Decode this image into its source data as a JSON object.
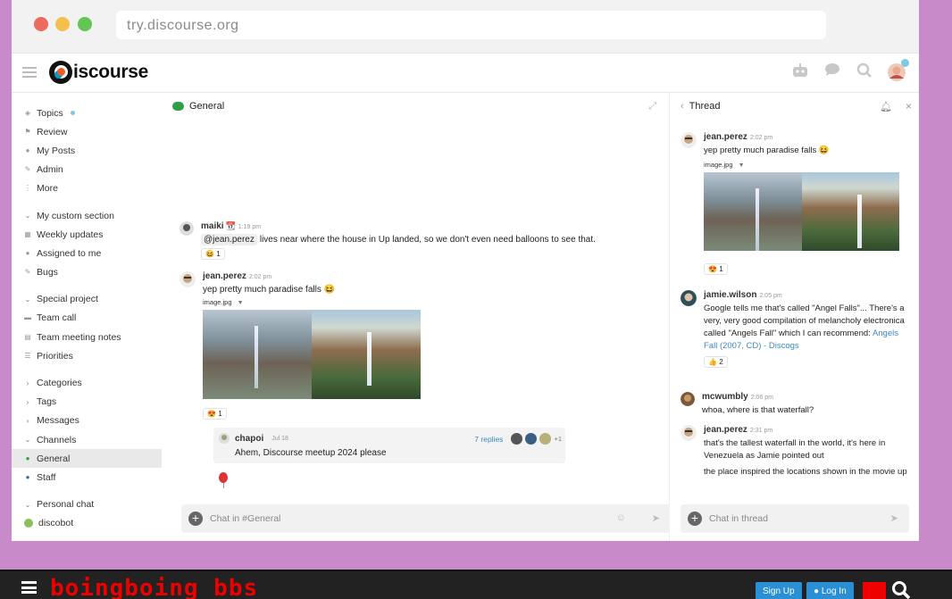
{
  "browser": {
    "url": "try.discourse.org"
  },
  "header": {
    "logo_text": "iscourse"
  },
  "sidebar": {
    "items": [
      {
        "label": "Topics",
        "icon": "layers-icon"
      },
      {
        "label": "Review",
        "icon": "flag-icon"
      },
      {
        "label": "My Posts",
        "icon": "user-icon"
      },
      {
        "label": "Admin",
        "icon": "wrench-icon"
      },
      {
        "label": "More",
        "icon": "ellipsis-icon"
      }
    ],
    "custom_section": {
      "title": "My custom section",
      "items": [
        "Weekly updates",
        "Assigned to me",
        "Bugs"
      ]
    },
    "special_project": {
      "title": "Special project",
      "items": [
        "Team call",
        "Team meeting notes",
        "Priorities"
      ]
    },
    "categories": "Categories",
    "tags": "Tags",
    "messages": "Messages",
    "channels": {
      "title": "Channels",
      "items": [
        "General",
        "Staff"
      ]
    },
    "personal_chat": {
      "title": "Personal chat",
      "items": [
        "discobot"
      ]
    }
  },
  "channel": {
    "title": "General",
    "messages": [
      {
        "user": "maiki",
        "time": "1:19 pm",
        "mention": "@jean.perez",
        "text": "lives near where the house in Up landed, so we don't even need balloons to see that.",
        "reaction": "😆",
        "reaction_count": "1"
      },
      {
        "user": "jean.perez",
        "time": "2:02 pm",
        "text": "yep pretty much paradise falls 😆",
        "image_name": "image.jpg",
        "reaction": "😍",
        "reaction_count": "1"
      }
    ],
    "thread_preview": {
      "user": "chapoi",
      "time": "Jul 18",
      "text": "Ahem, Discourse meetup 2024 please",
      "replies": "7 replies",
      "more": "+1"
    },
    "composer_placeholder": "Chat in #General"
  },
  "thread": {
    "title": "Thread",
    "messages": [
      {
        "user": "jean.perez",
        "time": "2:02 pm",
        "text": "yep pretty much paradise falls 😆",
        "image_name": "image.jpg",
        "reaction": "😍",
        "reaction_count": "1"
      },
      {
        "user": "jamie.wilson",
        "time": "2:05 pm",
        "text": "Google tells me that's called \"Angel Falls\"... There's a very, very good compilation of melancholy electronica called \"Angels Fall\" which I can recommend:",
        "link": "Angels Fall (2007, CD) - Discogs",
        "reaction": "👍",
        "reaction_count": "2"
      },
      {
        "user": "mcwumbly",
        "time": "2:06 pm",
        "text": "whoa, where is that waterfall?"
      },
      {
        "user": "jean.perez",
        "time": "2:31 pm",
        "text": "that's the tallest waterfall in the world, it's here in Venezuela as Jamie pointed out",
        "text2": "the place inspired the locations shown in the movie up"
      }
    ],
    "composer_placeholder": "Chat in thread"
  },
  "bbs": {
    "logo": "boingboing bbs",
    "signup": "Sign Up",
    "login": "Log In"
  }
}
